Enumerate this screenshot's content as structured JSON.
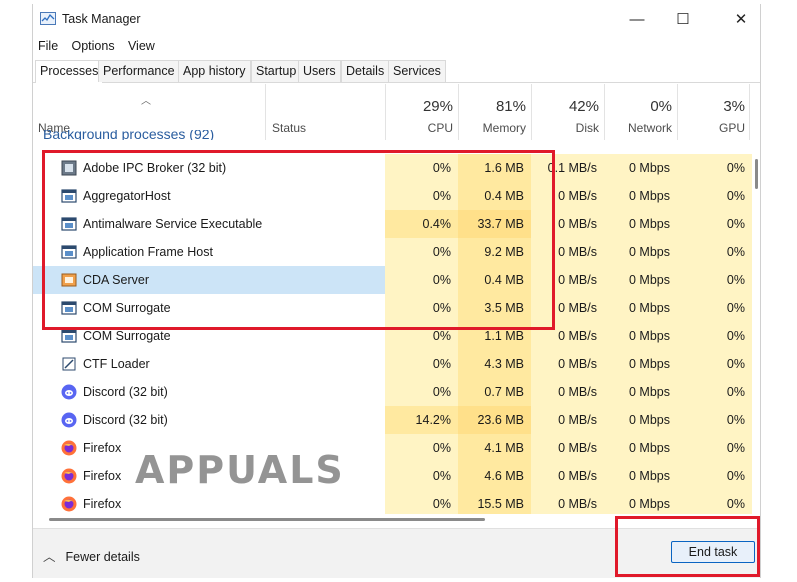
{
  "window": {
    "title": "Task Manager",
    "controls": [
      "—",
      "☐",
      "✕"
    ]
  },
  "menu": [
    "File",
    "Options",
    "View"
  ],
  "tabs": [
    "Processes",
    "Performance",
    "App history",
    "Startup",
    "Users",
    "Details",
    "Services"
  ],
  "columns": {
    "name": "Name",
    "status": "Status",
    "cpu": {
      "pct": "29%",
      "label": "CPU"
    },
    "memory": {
      "pct": "81%",
      "label": "Memory"
    },
    "disk": {
      "pct": "42%",
      "label": "Disk"
    },
    "network": {
      "pct": "0%",
      "label": "Network"
    },
    "gpu": {
      "pct": "3%",
      "label": "GPU"
    }
  },
  "group_header": "Background processes (92)",
  "rows": [
    {
      "name": "Adobe IPC Broker (32 bit)",
      "cpu": "0%",
      "mem": "1.6 MB",
      "disk": "0.1 MB/s",
      "net": "0 Mbps",
      "gpu": "0%",
      "icon": "adobe-icon"
    },
    {
      "name": "AggregatorHost",
      "cpu": "0%",
      "mem": "0.4 MB",
      "disk": "0 MB/s",
      "net": "0 Mbps",
      "gpu": "0%",
      "icon": "app-window-icon"
    },
    {
      "name": "Antimalware Service Executable",
      "cpu": "0.4%",
      "mem": "33.7 MB",
      "disk": "0 MB/s",
      "net": "0 Mbps",
      "gpu": "0%",
      "icon": "app-window-icon"
    },
    {
      "name": "Application Frame Host",
      "cpu": "0%",
      "mem": "9.2 MB",
      "disk": "0 MB/s",
      "net": "0 Mbps",
      "gpu": "0%",
      "icon": "app-window-icon"
    },
    {
      "name": "CDA Server",
      "cpu": "0%",
      "mem": "0.4 MB",
      "disk": "0 MB/s",
      "net": "0 Mbps",
      "gpu": "0%",
      "icon": "cda-icon"
    },
    {
      "name": "COM Surrogate",
      "cpu": "0%",
      "mem": "3.5 MB",
      "disk": "0 MB/s",
      "net": "0 Mbps",
      "gpu": "0%",
      "icon": "app-window-icon"
    },
    {
      "name": "COM Surrogate",
      "cpu": "0%",
      "mem": "1.1 MB",
      "disk": "0 MB/s",
      "net": "0 Mbps",
      "gpu": "0%",
      "icon": "app-window-icon"
    },
    {
      "name": "CTF Loader",
      "cpu": "0%",
      "mem": "4.3 MB",
      "disk": "0 MB/s",
      "net": "0 Mbps",
      "gpu": "0%",
      "icon": "ctf-icon"
    },
    {
      "name": "Discord (32 bit)",
      "cpu": "0%",
      "mem": "0.7 MB",
      "disk": "0 MB/s",
      "net": "0 Mbps",
      "gpu": "0%",
      "icon": "discord-icon"
    },
    {
      "name": "Discord (32 bit)",
      "cpu": "14.2%",
      "mem": "23.6 MB",
      "disk": "0 MB/s",
      "net": "0 Mbps",
      "gpu": "0%",
      "icon": "discord-icon"
    },
    {
      "name": "Firefox",
      "cpu": "0%",
      "mem": "4.1 MB",
      "disk": "0 MB/s",
      "net": "0 Mbps",
      "gpu": "0%",
      "icon": "firefox-icon"
    },
    {
      "name": "Firefox",
      "cpu": "0%",
      "mem": "4.6 MB",
      "disk": "0 MB/s",
      "net": "0 Mbps",
      "gpu": "0%",
      "icon": "firefox-icon"
    },
    {
      "name": "Firefox",
      "cpu": "0%",
      "mem": "15.5 MB",
      "disk": "0 MB/s",
      "net": "0 Mbps",
      "gpu": "0%",
      "icon": "firefox-icon"
    }
  ],
  "selected_row": 4,
  "footer": {
    "fewer_details": "Fewer details",
    "end_task": "End task"
  },
  "watermark": "APPUALS",
  "colors": {
    "cell_light": "#fff4c4",
    "cell_mid": "#ffe9a0",
    "selected": "#cce4f7",
    "highlight_box": "#e0192a",
    "accent": "#0a64c2"
  }
}
